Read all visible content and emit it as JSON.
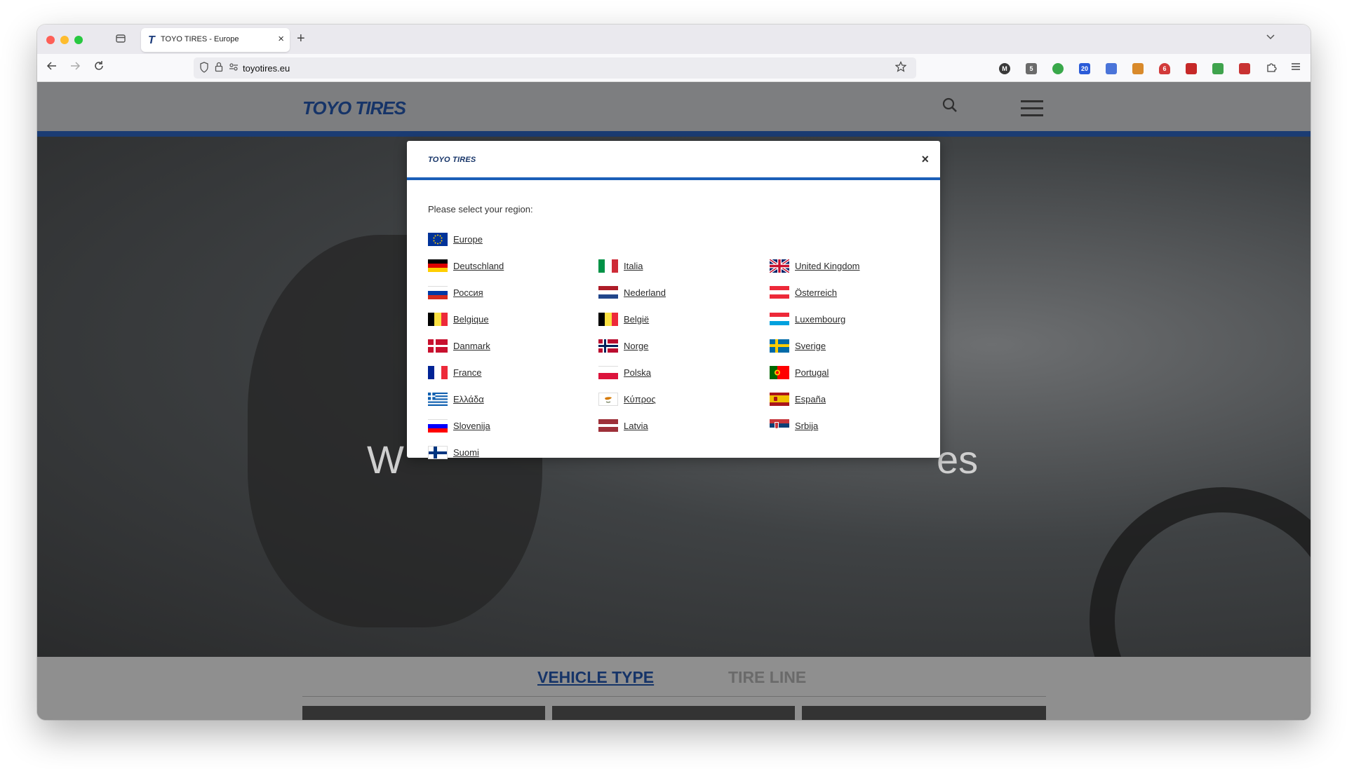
{
  "browser": {
    "tab_title": "TOYO TIRES - Europe",
    "tab_favicon": "T",
    "tab_close": "×",
    "new_tab": "+",
    "url": "toyotires.eu",
    "icons": [
      "back-arrow-icon",
      "forward-arrow-icon",
      "reload-icon",
      "shield-icon",
      "lock-icon",
      "permissions-icon",
      "star-icon",
      "extensions-icon",
      "menu-icon"
    ],
    "extensions": [
      {
        "name": "m-extension-icon",
        "badge": "M",
        "color": "#3a3a3a"
      },
      {
        "name": "clipboard-extension-icon",
        "badge": "5",
        "color": "#6b6b6b"
      },
      {
        "name": "green-cycle-extension-icon",
        "badge": "",
        "color": "#39a84a"
      },
      {
        "name": "calendar-extension-icon",
        "badge": "20",
        "color": "#2b5bd8"
      },
      {
        "name": "translate-extension-icon",
        "badge": "",
        "color": "#4a74d9"
      },
      {
        "name": "pen-extension-icon",
        "badge": "",
        "color": "#d98a2b"
      },
      {
        "name": "shield-red-extension-icon",
        "badge": "6",
        "color": "#d23a3a"
      },
      {
        "name": "ublock-extension-icon",
        "badge": "",
        "color": "#c62828"
      },
      {
        "name": "money-extension-icon",
        "badge": "",
        "color": "#3fa34d"
      },
      {
        "name": "redpen-extension-icon",
        "badge": "",
        "color": "#c83232"
      }
    ]
  },
  "site": {
    "logo": "TOYO TIRES",
    "hero_text_left": "W",
    "hero_text_right": "es",
    "bottom_tabs": [
      "VEHICLE TYPE",
      "TIRE LINE"
    ]
  },
  "modal": {
    "logo": "TOYO TIRES",
    "close": "×",
    "prompt": "Please select your region:",
    "regions": [
      {
        "label": "Europe",
        "flag": "eu"
      },
      {
        "label": "Deutschland",
        "flag": "de"
      },
      {
        "label": "Россия",
        "flag": "ru"
      },
      {
        "label": "Belgique",
        "flag": "be"
      },
      {
        "label": "Danmark",
        "flag": "dk"
      },
      {
        "label": "France",
        "flag": "fr"
      },
      {
        "label": "Ελλάδα",
        "flag": "gr"
      },
      {
        "label": "Slovenija",
        "flag": "si"
      },
      {
        "label": "Suomi",
        "flag": "fi"
      },
      {
        "label": "Italia",
        "flag": "it"
      },
      {
        "label": "Nederland",
        "flag": "nl"
      },
      {
        "label": "België",
        "flag": "be"
      },
      {
        "label": "Norge",
        "flag": "no"
      },
      {
        "label": "Polska",
        "flag": "pl"
      },
      {
        "label": "Κύπρος",
        "flag": "cy"
      },
      {
        "label": "Latvia",
        "flag": "lv"
      },
      {
        "label": "United Kingdom",
        "flag": "gb"
      },
      {
        "label": "Österreich",
        "flag": "at"
      },
      {
        "label": "Luxembourg",
        "flag": "lu"
      },
      {
        "label": "Sverige",
        "flag": "se"
      },
      {
        "label": "Portugal",
        "flag": "pt"
      },
      {
        "label": "España",
        "flag": "es"
      },
      {
        "label": "Srbija",
        "flag": "rs"
      }
    ]
  }
}
